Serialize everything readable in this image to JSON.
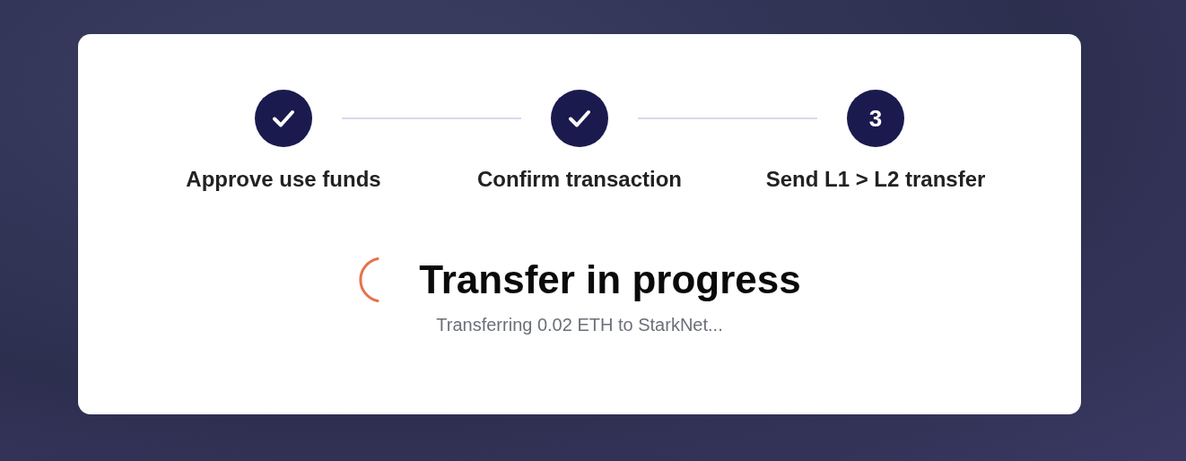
{
  "steps": [
    {
      "label": "Approve use funds",
      "done": true
    },
    {
      "label": "Confirm transaction",
      "done": true
    },
    {
      "label": "Send L1 > L2 transfer",
      "done": false,
      "number": "3"
    }
  ],
  "status": {
    "title": "Transfer in progress",
    "loading": true,
    "message": "Transferring 0.02 ETH to StarkNet..."
  }
}
